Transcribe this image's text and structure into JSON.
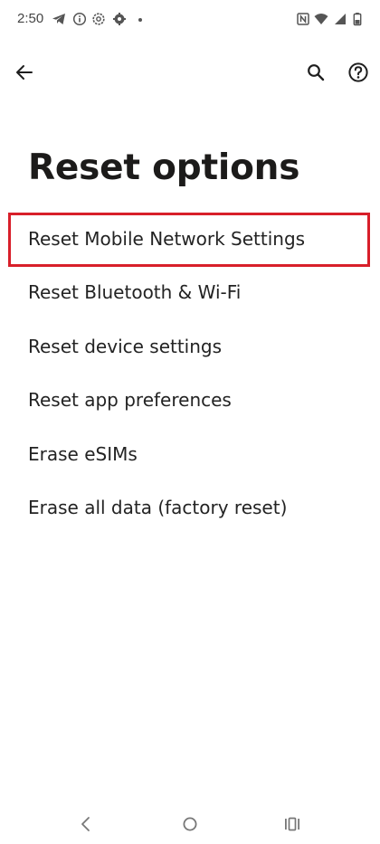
{
  "status_bar": {
    "time": "2:50",
    "left_icons": [
      "telegram-icon",
      "info-icon",
      "settings-outline-icon",
      "gear-icon",
      "dot-icon"
    ],
    "right_icons": [
      "nfc-icon",
      "wifi-icon",
      "signal-icon",
      "battery-icon"
    ]
  },
  "app_bar": {
    "back_icon": "arrow-left-icon",
    "search_icon": "search-icon",
    "help_icon": "help-circle-icon"
  },
  "page": {
    "title": "Reset options"
  },
  "options": [
    {
      "label": "Reset Mobile Network Settings",
      "highlighted": true
    },
    {
      "label": "Reset Bluetooth & Wi-Fi"
    },
    {
      "label": "Reset device settings"
    },
    {
      "label": "Reset app preferences"
    },
    {
      "label": "Erase eSIMs"
    },
    {
      "label": "Erase all data (factory reset)"
    }
  ],
  "nav_bar": {
    "back": "nav-back-icon",
    "home": "nav-home-icon",
    "recents": "nav-recents-icon"
  },
  "colors": {
    "highlight": "#d81f2a",
    "text": "#232323",
    "background": "#ffffff"
  }
}
